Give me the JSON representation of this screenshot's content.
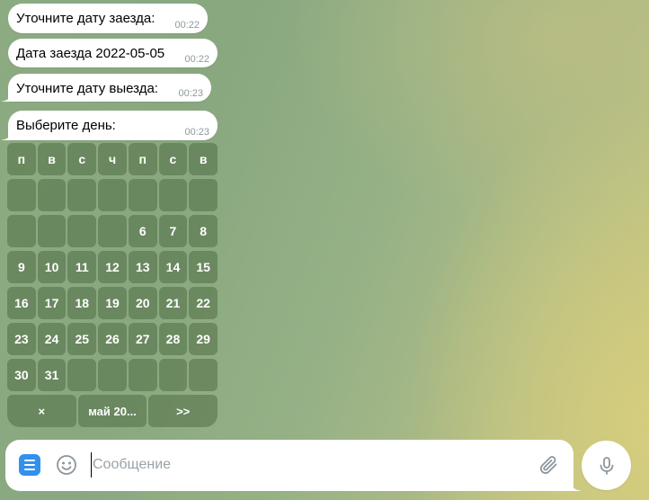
{
  "messages": [
    {
      "text": "Уточните дату заезда:",
      "time": "00:22"
    },
    {
      "text": "Дата заезда 2022-05-05",
      "time": "00:22"
    },
    {
      "text": "Уточните дату выезда:",
      "time": "00:23"
    },
    {
      "text": "Выберите день:",
      "time": "00:23"
    }
  ],
  "calendar": {
    "weekdays": [
      "п",
      "в",
      "с",
      "ч",
      "п",
      "с",
      "в"
    ],
    "weeks": [
      [
        "",
        "",
        "",
        "",
        "",
        "",
        ""
      ],
      [
        "",
        "",
        "",
        "",
        "6",
        "7",
        "8"
      ],
      [
        "9",
        "10",
        "11",
        "12",
        "13",
        "14",
        "15"
      ],
      [
        "16",
        "17",
        "18",
        "19",
        "20",
        "21",
        "22"
      ],
      [
        "23",
        "24",
        "25",
        "26",
        "27",
        "28",
        "29"
      ],
      [
        "30",
        "31",
        "",
        "",
        "",
        "",
        ""
      ]
    ],
    "nav": {
      "cancel": "×",
      "month": "май 20...",
      "next": ">>"
    }
  },
  "composer": {
    "placeholder": "Сообщение",
    "value": ""
  },
  "icons": {
    "menu": "menu-icon",
    "emoji": "emoji-icon",
    "attach": "paperclip-icon",
    "mic": "microphone-icon"
  },
  "colors": {
    "accent": "#3390ec",
    "icon_gray": "#8d969c"
  }
}
